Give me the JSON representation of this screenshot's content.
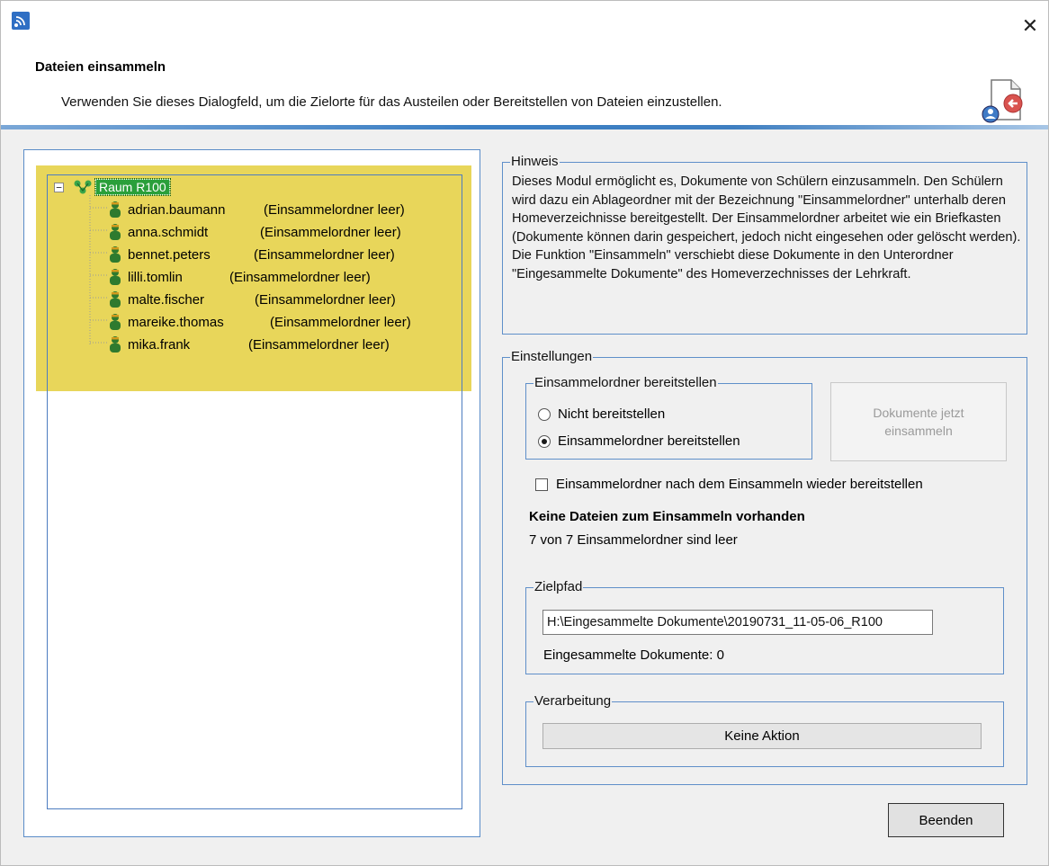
{
  "header": {
    "title": "Dateien einsammeln",
    "description": "Verwenden Sie dieses Dialogfeld, um die Zielorte für das Austeilen oder Bereitstellen von Dateien einzustellen.",
    "close_glyph": "✕",
    "app_icon": "wifi-app-icon",
    "header_icon": "collect-files-icon"
  },
  "tree": {
    "root_label": "Raum R100",
    "items": [
      {
        "name": "adrian.baumann",
        "status": "(Einsammelordner leer)"
      },
      {
        "name": "anna.schmidt",
        "status": "(Einsammelordner leer)"
      },
      {
        "name": "bennet.peters",
        "status": "(Einsammelordner leer)"
      },
      {
        "name": "lilli.tomlin",
        "status": "(Einsammelordner leer)"
      },
      {
        "name": "malte.fischer",
        "status": "(Einsammelordner leer)"
      },
      {
        "name": "mareike.thomas",
        "status": "(Einsammelordner leer)"
      },
      {
        "name": "mika.frank",
        "status": "(Einsammelordner leer)"
      }
    ],
    "highlight_color": "#e8d65a"
  },
  "hint": {
    "label": "Hinweis",
    "text": "Dieses Modul ermöglicht es, Dokumente von Schülern einzusammeln. Den Schülern wird dazu ein Ablageordner mit der Bezeichnung \"Einsammelordner\" unterhalb deren Homeverzeichnisse bereitgestellt. Der Einsammelordner arbeitet wie ein Briefkasten (Dokumente können darin gespeichert, jedoch nicht eingesehen oder gelöscht werden). Die Funktion \"Einsammeln\" verschiebt diese Dokumente in den Unterordner \"Eingesammelte Dokumente\"  des Homeverzechnisses der Lehrkraft."
  },
  "settings": {
    "label": "Einstellungen",
    "provide_group_label": "Einsammelordner bereitstellen",
    "radio_none": "Nicht bereitstellen",
    "radio_provide": "Einsammelordner bereitstellen",
    "collect_now_button": "Dokumente jetzt einsammeln",
    "reprovide_checkbox": "Einsammelordner nach dem Einsammeln wieder bereitstellen",
    "status_bold": "Keine Dateien zum Einsammeln vorhanden",
    "status_count": "7 von 7 Einsammelordner sind leer"
  },
  "target": {
    "label": "Zielpfad",
    "path": "H:\\Eingesammelte Dokumente\\20190731_11-05-06_R100",
    "doc_count": "Eingesammelte Dokumente: 0"
  },
  "processing": {
    "label": "Verarbeitung",
    "action_button": "Keine Aktion"
  },
  "footer": {
    "close_button": "Beenden"
  }
}
